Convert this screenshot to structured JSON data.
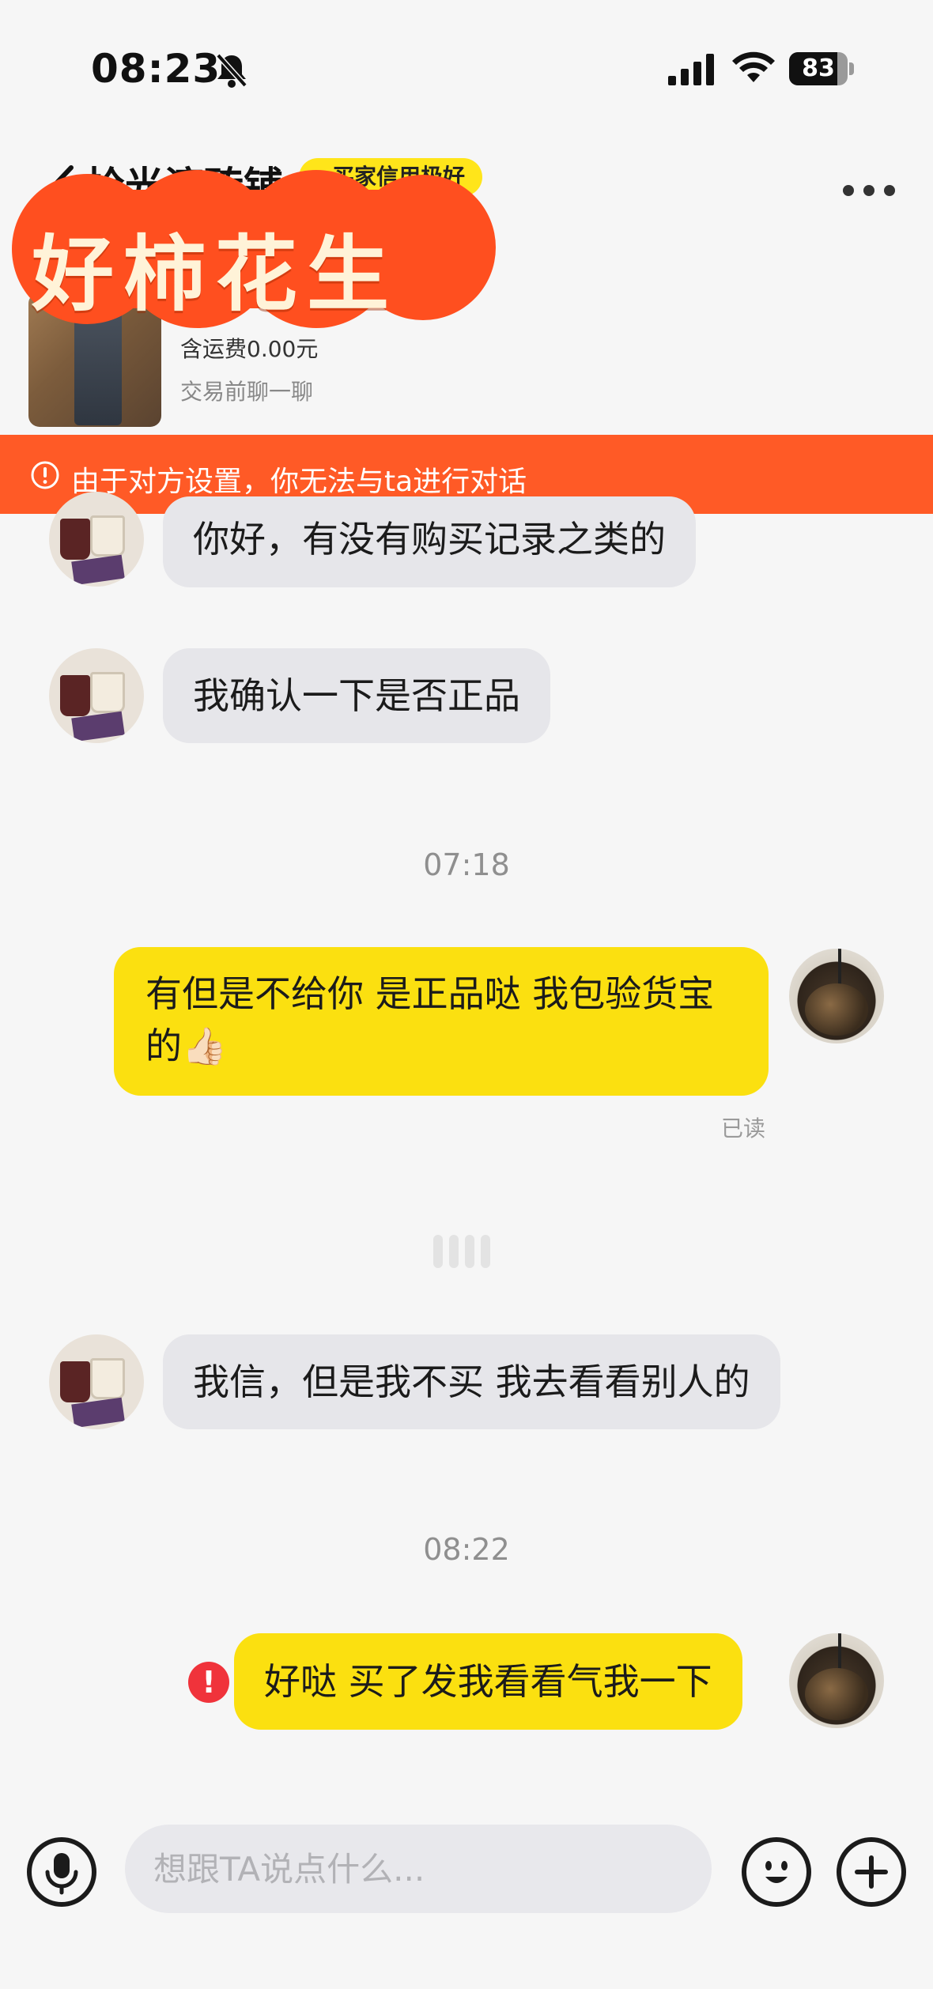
{
  "status_bar": {
    "time": "08:23",
    "battery_level": "83",
    "battery_fraction": 0.83,
    "icons": [
      "bell-muted-icon",
      "signal-icon",
      "wifi-icon",
      "battery-icon"
    ]
  },
  "header": {
    "shop_name": "拾光滚砖铺",
    "credit_badge": "买家信用极好",
    "product_shipping": "含运费0.00元",
    "product_chat_hint": "交易前聊一聊"
  },
  "stamp": {
    "text": "好柿花生",
    "fill_color": "#ff4f1f"
  },
  "warning": {
    "text": "由于对方设置，你无法与ta进行对话",
    "color": "#ff5a26"
  },
  "messages": [
    {
      "side": "in",
      "text": "你好，有没有购买记录之类的"
    },
    {
      "side": "in",
      "text": "我确认一下是否正品"
    },
    {
      "type": "time",
      "text": "07:18"
    },
    {
      "side": "out",
      "text_line1": "有但是不给你 是正品哒 我包验货宝",
      "text_line2": "的👍🏻",
      "read": "已读"
    },
    {
      "side": "in",
      "text": "我信，但是我不买 我去看看别人的"
    },
    {
      "type": "time",
      "text": "08:22"
    },
    {
      "side": "out",
      "text": "好哒 买了发我看看气我一下",
      "error": "!"
    }
  ],
  "input": {
    "placeholder": "想跟TA说点什么..."
  },
  "colors": {
    "outgoing_bubble": "#fbe010",
    "incoming_bubble": "#e6e6ea",
    "error": "#f0333b"
  }
}
